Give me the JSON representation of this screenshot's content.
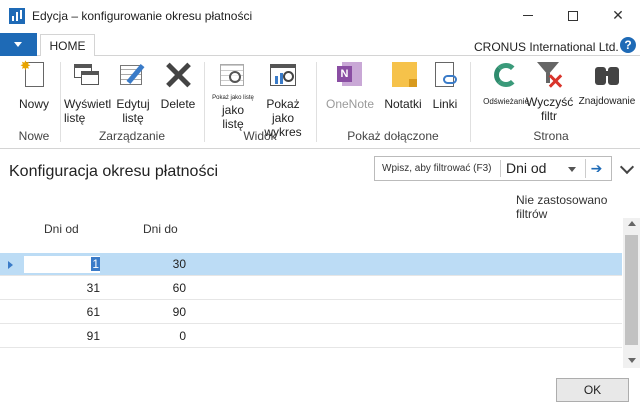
{
  "window": {
    "title": "Edycja – konfigurowanie okresu płatności",
    "controls": [
      "minimize",
      "maximize",
      "close"
    ]
  },
  "ribbon_tabs": {
    "home_label": "HOME",
    "company": "CRONUS International Ltd.",
    "help_glyph": "?"
  },
  "ribbon": {
    "new_label": "Nowy",
    "view_list_label": "Wyświetl listę",
    "edit_list_label": "Edytuj listę",
    "delete_label": "Delete",
    "show_as_list_small": "Pokaż jako listę",
    "show_as_list_label": "jako listę",
    "show_as_chart_label": "Pokaż jako wykres",
    "onenote_label": "OneNote",
    "notes_label": "Notatki",
    "links_label": "Linki",
    "refresh_label": "Odświeżanie",
    "clear_filter_label": "Wyczyść filtr",
    "find_label": "Znajdowanie",
    "groups": {
      "new": "Nowe",
      "manage": "Zarządzanie",
      "view": "Widok",
      "attached": "Pokaż dołączone",
      "page": "Strona"
    }
  },
  "page": {
    "title": "Konfiguracja okresu płatności",
    "filter_placeholder": "Wpisz, aby filtrować (F3)",
    "filter_field": "Dni od",
    "filter_status": "Nie zastosowano filtrów"
  },
  "table": {
    "columns": [
      "Dni od",
      "Dni do"
    ],
    "rows": [
      {
        "from": "1",
        "to": "30",
        "selected": true
      },
      {
        "from": "31",
        "to": "60",
        "selected": false
      },
      {
        "from": "61",
        "to": "90",
        "selected": false
      },
      {
        "from": "91",
        "to": "0",
        "selected": false
      }
    ]
  },
  "footer": {
    "ok_label": "OK"
  }
}
